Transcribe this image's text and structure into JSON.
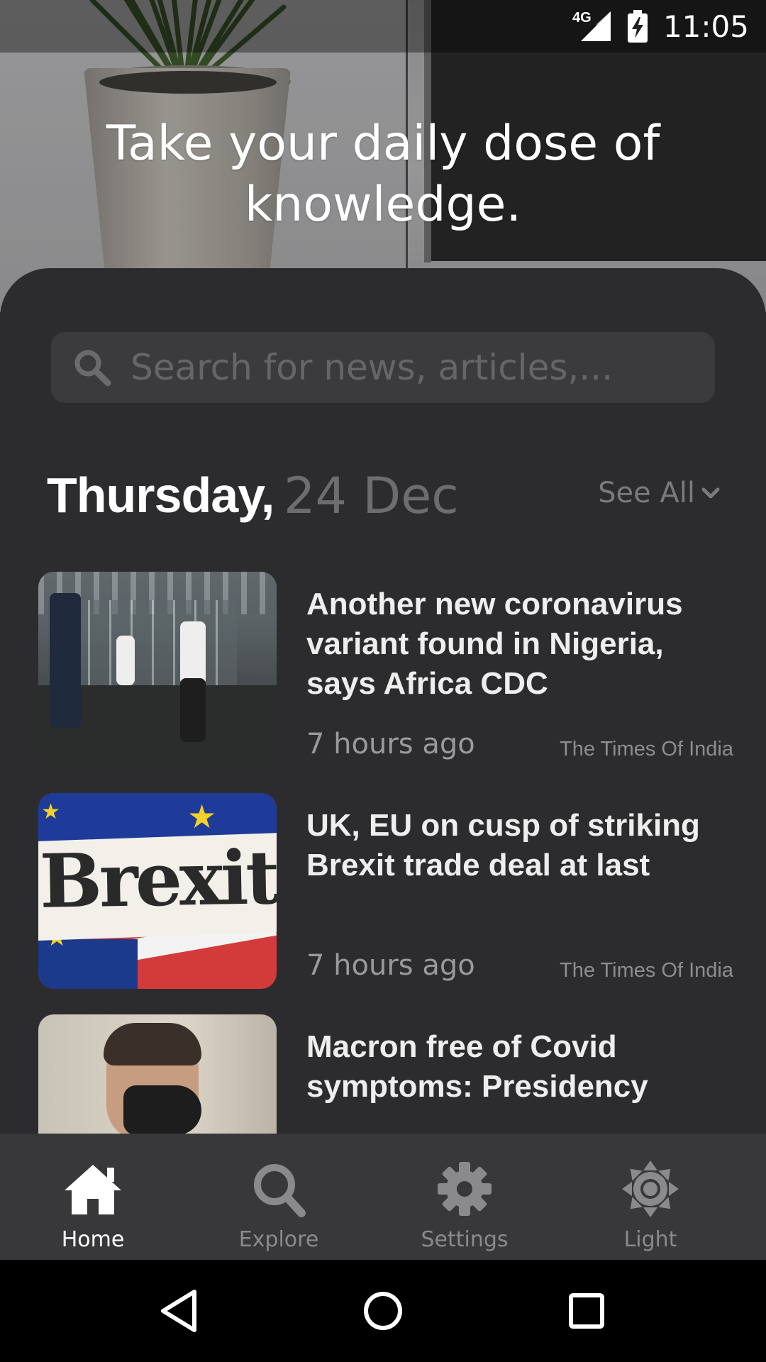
{
  "status_bar": {
    "network": "4G",
    "time": "11:05"
  },
  "hero": {
    "title": "Take your daily dose of knowledge."
  },
  "search": {
    "placeholder": "Search for news, articles,..."
  },
  "date_header": {
    "day": "Thursday,",
    "date": "24 Dec",
    "see_all": "See All"
  },
  "articles": [
    {
      "title": "Another new coronavirus variant found in Nigeria, says Africa CDC",
      "time": "7 hours ago",
      "source": "The Times Of India"
    },
    {
      "title": "UK, EU on cusp of striking Brexit trade deal at last",
      "time": "7 hours ago",
      "source": "The Times Of India",
      "thumb_text": "Brexit"
    },
    {
      "title": "Macron free of Covid symptoms: Presidency"
    }
  ],
  "bottom_nav": [
    {
      "label": "Home",
      "icon": "home-icon",
      "active": true
    },
    {
      "label": "Explore",
      "icon": "search-icon",
      "active": false
    },
    {
      "label": "Settings",
      "icon": "gear-icon",
      "active": false
    },
    {
      "label": "Light",
      "icon": "sun-icon",
      "active": false
    }
  ],
  "colors": {
    "background": "#2c2c2e",
    "nav": "#38383a",
    "active": "#ffffff",
    "inactive": "#8a8a8c"
  }
}
